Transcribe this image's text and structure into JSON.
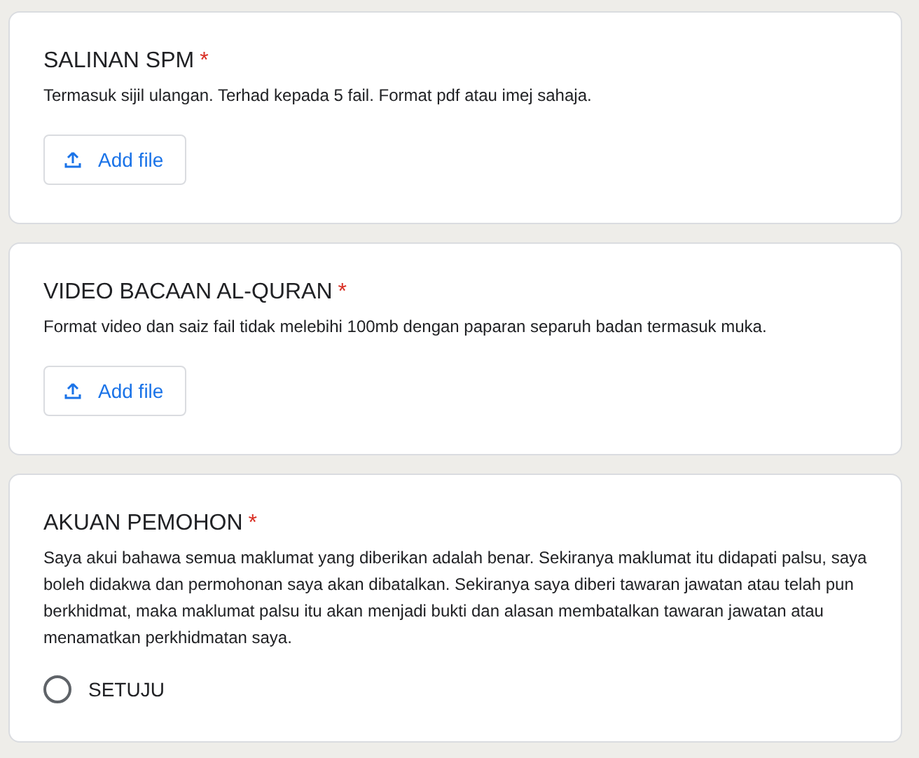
{
  "questions": [
    {
      "kind": "file",
      "title": "SALINAN SPM",
      "required_mark": "*",
      "description": "Termasuk sijil ulangan. Terhad kepada 5 fail. Format pdf atau imej sahaja.",
      "button": "Add file"
    },
    {
      "kind": "file",
      "title": "VIDEO BACAAN AL-QURAN",
      "required_mark": "*",
      "description": "Format video dan saiz fail tidak melebihi 100mb dengan paparan separuh badan termasuk muka.",
      "button": "Add file"
    },
    {
      "kind": "radio",
      "title": "AKUAN PEMOHON",
      "required_mark": "*",
      "description": "Saya akui bahawa semua maklumat yang diberikan adalah benar. Sekiranya maklumat itu didapati palsu, saya boleh didakwa dan permohonan saya akan dibatalkan. Sekiranya saya diberi tawaran jawatan atau telah pun berkhidmat, maka maklumat palsu itu akan menjadi bukti dan alasan membatalkan tawaran jawatan atau menamatkan perkhidmatan saya.",
      "options": [
        {
          "label": "SETUJU",
          "selected": false
        }
      ]
    }
  ]
}
